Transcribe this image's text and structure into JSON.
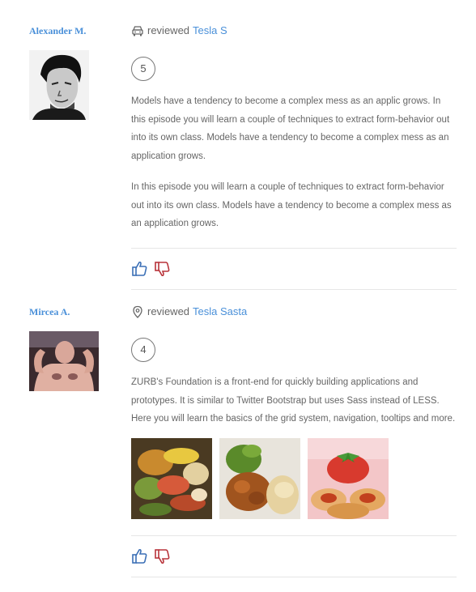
{
  "reviews": [
    {
      "author": "Alexander M.",
      "avatar": "man-portrait-avatar",
      "reviewed_label": "reviewed",
      "item_icon": "car-icon",
      "item_link": "Tesla S",
      "rating": "5",
      "paragraphs": [
        "Models have a tendency to become a complex mess as an applic grows. In this episode you will learn a couple of techniques to extract form-behavior out into its own class. Models have a tendency to become a complex mess as an application grows.",
        "In this episode you will learn a couple of techniques to extract form-behavior out into its own class. Models have a tendency to become a complex mess as an application grows."
      ],
      "like_icon": "thumbs-up-icon",
      "dislike_icon": "thumbs-down-icon"
    },
    {
      "author": "Mircea A.",
      "avatar": "person-photo-avatar",
      "reviewed_label": "reviewed",
      "item_icon": "location-pin-icon",
      "item_link": "Tesla Sasta",
      "rating": "4",
      "paragraphs": [
        "ZURB's Foundation is a front-end for quickly building applications and prototypes. It is similar to Twitter Bootstrap but uses Sass instead of LESS. Here you will learn the basics of the grid system, navigation, tooltips and more."
      ],
      "photos": [
        "food-photo-vegetables",
        "food-photo-meat-salad",
        "food-photo-strawberry-dessert"
      ],
      "like_icon": "thumbs-up-icon",
      "dislike_icon": "thumbs-down-icon"
    }
  ],
  "colors": {
    "link": "#4a90d9",
    "like": "#3b6fb6",
    "dislike": "#b8333a",
    "text": "#666666",
    "divider": "#e6e6e6"
  }
}
